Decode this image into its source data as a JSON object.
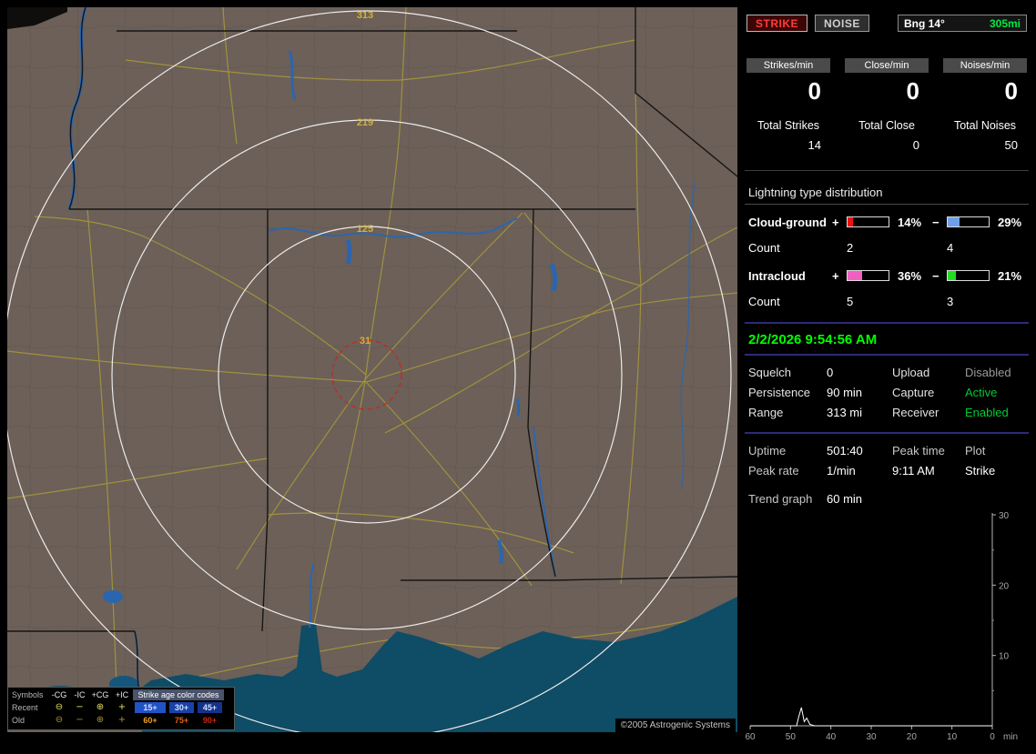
{
  "window": {
    "copyright": "©2005 Astrogenic Systems"
  },
  "map": {
    "range_ring_labels": [
      "313",
      "219",
      "125",
      "31"
    ],
    "colors": {
      "land": "#6c6058",
      "water": "#0f4c66",
      "river": "#2a66b0",
      "road": "#a3943e",
      "state_border": "#161616",
      "range_ring": "#ebebeb",
      "alarm_ring": "#cc2222",
      "ring_label": "#d2b23c"
    },
    "legend": {
      "symbols_label": "Symbols",
      "columns": [
        "-CG",
        "-IC",
        "+CG",
        "+IC"
      ],
      "age_header": "Strike age color codes",
      "symbols": [
        "⊖",
        "−",
        "⊕",
        "+"
      ],
      "rows": [
        {
          "label": "Recent",
          "symbol_color": "#e8e05a",
          "ages": [
            {
              "text": "15+",
              "color": "#cfe0ff",
              "bg": "#2253c6"
            },
            {
              "text": "30+",
              "color": "#cfe0ff",
              "bg": "#1a41a6"
            },
            {
              "text": "45+",
              "color": "#cfe0ff",
              "bg": "#14328c"
            }
          ]
        },
        {
          "label": "Old",
          "symbol_color": "#a89530",
          "ages": [
            {
              "text": "60+",
              "color": "#f0a020",
              "bg": "#000000"
            },
            {
              "text": "75+",
              "color": "#e86414",
              "bg": "#000000"
            },
            {
              "text": "90+",
              "color": "#d42410",
              "bg": "#000000"
            }
          ]
        }
      ]
    }
  },
  "panel": {
    "strike_button": "STRIKE",
    "noise_button": "NOISE",
    "bearing_label": "Bng 14°",
    "bearing_distance": "305mi",
    "counters": [
      {
        "label": "Strikes/min",
        "value": "0",
        "total_label": "Total Strikes",
        "total": "14"
      },
      {
        "label": "Close/min",
        "value": "0",
        "total_label": "Total Close",
        "total": "0"
      },
      {
        "label": "Noises/min",
        "value": "0",
        "total_label": "Total Noises",
        "total": "50"
      }
    ],
    "distribution": {
      "title": "Lightning type distribution",
      "count_label": "Count",
      "rows": [
        {
          "name": "Cloud-ground",
          "plus_sign": "+",
          "plus_pct": "14%",
          "plus_pct_value": 14,
          "plus_color": "#ee1111",
          "minus_sign": "−",
          "minus_pct": "29%",
          "minus_pct_value": 29,
          "minus_color": "#6f9fe8",
          "plus_count": "2",
          "minus_count": "4"
        },
        {
          "name": "Intracloud",
          "plus_sign": "+",
          "plus_pct": "36%",
          "plus_pct_value": 36,
          "plus_color": "#f060c0",
          "minus_sign": "−",
          "minus_pct": "21%",
          "minus_pct_value": 21,
          "minus_color": "#22dd22",
          "plus_count": "5",
          "minus_count": "3"
        }
      ]
    },
    "datetime": "2/2/2026 9:54:56 AM",
    "settings": {
      "rows": [
        {
          "l1": "Squelch",
          "v1": "0",
          "l2": "Upload",
          "v2": "Disabled",
          "v2_color": "#9a9a9a"
        },
        {
          "l1": "Persistence",
          "v1": "90 min",
          "l2": "Capture",
          "v2": "Active",
          "v2_color": "#00cc33"
        },
        {
          "l1": "Range",
          "v1": "313 mi",
          "l2": "Receiver",
          "v2": "Enabled",
          "v2_color": "#00cc33"
        }
      ]
    },
    "stats": {
      "uptime_label": "Uptime",
      "uptime_value": "501:40",
      "peak_time_label": "Peak time",
      "peak_time_value": "9:11 AM",
      "plot_label": "Plot",
      "plot_value": "Strike",
      "peak_rate_label": "Peak rate",
      "peak_rate_value": "1/min",
      "trend_label": "Trend graph",
      "trend_value": "60 min"
    }
  },
  "chart_data": {
    "type": "line",
    "xlabel": "min",
    "x_ticks": [
      60,
      50,
      40,
      30,
      20,
      10,
      0
    ],
    "y_ticks": [
      10,
      20,
      30
    ],
    "y_minor_ticks": [
      5,
      15,
      25
    ],
    "xlim": [
      60,
      0
    ],
    "ylim": [
      0,
      30
    ],
    "grid": false,
    "legend_position": "none",
    "series": [
      {
        "name": "Strike",
        "color": "#ffffff",
        "points": [
          [
            60,
            0
          ],
          [
            50,
            0
          ],
          [
            48.5,
            0
          ],
          [
            48,
            1.2
          ],
          [
            47.3,
            2.6
          ],
          [
            46.6,
            0.6
          ],
          [
            46,
            1.1
          ],
          [
            45.2,
            0.2
          ],
          [
            44,
            0
          ],
          [
            30,
            0
          ],
          [
            20,
            0
          ],
          [
            10,
            0
          ],
          [
            0,
            0
          ]
        ]
      }
    ]
  }
}
